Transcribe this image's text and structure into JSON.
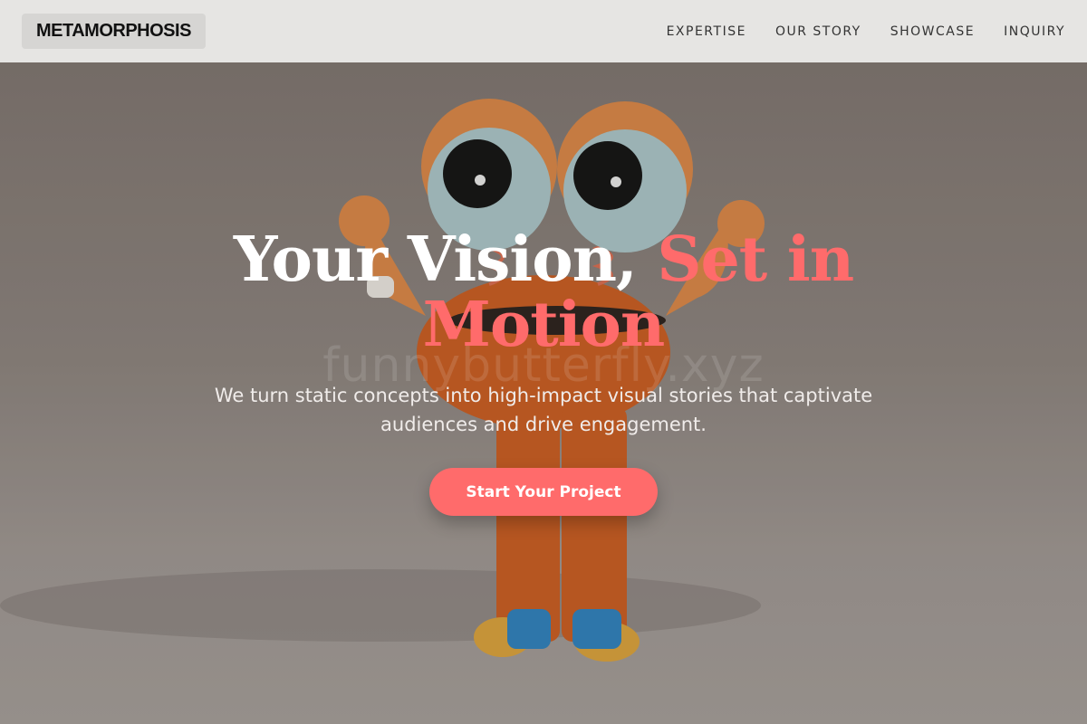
{
  "nav": {
    "logo": "METAMORPHOSIS",
    "links": [
      "EXPERTISE",
      "OUR STORY",
      "SHOWCASE",
      "INQUIRY"
    ]
  },
  "hero": {
    "headline_main": "Your Vision, ",
    "headline_accent": "Set in Motion",
    "watermark": "funnybutterfly.xyz",
    "subtitle": "We turn static concepts into high-impact visual stories that captivate audiences and drive engagement.",
    "cta_label": "Start Your Project"
  },
  "colors": {
    "accent": "#ff6b6b",
    "nav_background": "#e6e5e3",
    "headline": "#ffffff"
  },
  "icons": [
    "character-illustration"
  ]
}
